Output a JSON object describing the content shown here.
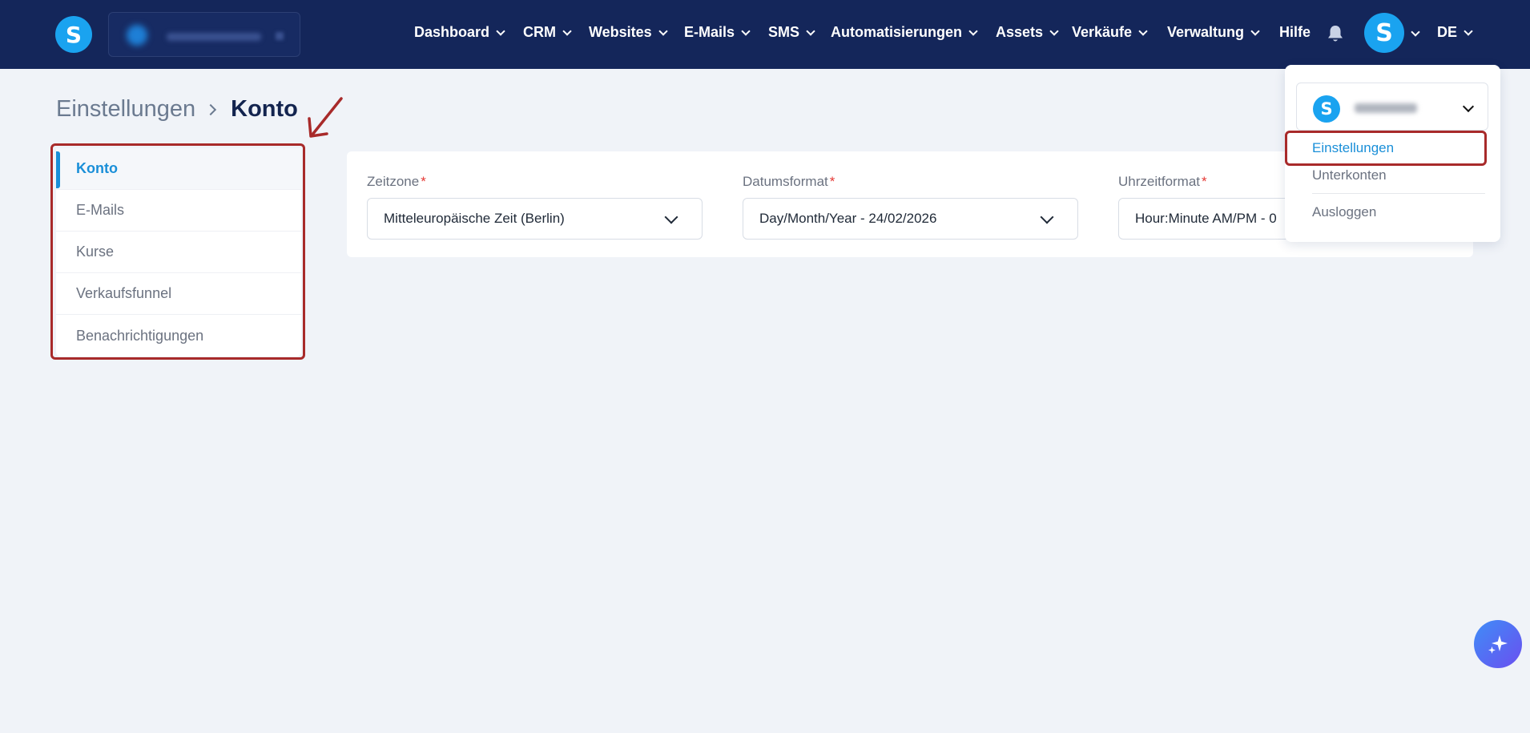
{
  "header": {
    "logo_letter": "S",
    "nav": [
      {
        "label": "Dashboard",
        "has_dropdown": true
      },
      {
        "label": "CRM",
        "has_dropdown": true
      },
      {
        "label": "Websites",
        "has_dropdown": true
      },
      {
        "label": "E-Mails",
        "has_dropdown": true
      },
      {
        "label": "SMS",
        "has_dropdown": true
      },
      {
        "label": "Automatisierungen",
        "has_dropdown": true
      },
      {
        "label": "Assets",
        "has_dropdown": true
      },
      {
        "label": "Verkäufe",
        "has_dropdown": true
      },
      {
        "label": "Verwaltung",
        "has_dropdown": true
      },
      {
        "label": "Hilfe",
        "has_dropdown": false
      }
    ],
    "avatar_letter": "S",
    "language": "DE",
    "icons": {
      "notifications": "bell-icon"
    }
  },
  "breadcrumb": {
    "parent": "Einstellungen",
    "current": "Konto"
  },
  "sidebar": {
    "items": [
      {
        "label": "Konto",
        "active": true
      },
      {
        "label": "E-Mails",
        "active": false
      },
      {
        "label": "Kurse",
        "active": false
      },
      {
        "label": "Verkaufsfunnel",
        "active": false
      },
      {
        "label": "Benachrichtigungen",
        "active": false
      }
    ]
  },
  "settings": {
    "fields": [
      {
        "label": "Zeitzone",
        "required_mark": "*",
        "value": "Mitteleuropäische Zeit (Berlin)"
      },
      {
        "label": "Datumsformat",
        "required_mark": "*",
        "value": "Day/Month/Year - 24/02/2026"
      },
      {
        "label": "Uhrzeitformat",
        "required_mark": "*",
        "value": "Hour:Minute AM/PM - 0"
      }
    ]
  },
  "user_menu": {
    "account_logo_letter": "S",
    "items": [
      {
        "label": "Einstellungen",
        "active": true
      },
      {
        "label": "Unterkonten",
        "active": false
      },
      {
        "label": "Ausloggen",
        "active": false
      }
    ]
  },
  "colors": {
    "header_bg": "#14265a",
    "accent": "#1a8fd8",
    "brand_blue": "#1aa3f0",
    "annotation_red": "#a82a2a",
    "page_bg": "#f0f3f8"
  }
}
